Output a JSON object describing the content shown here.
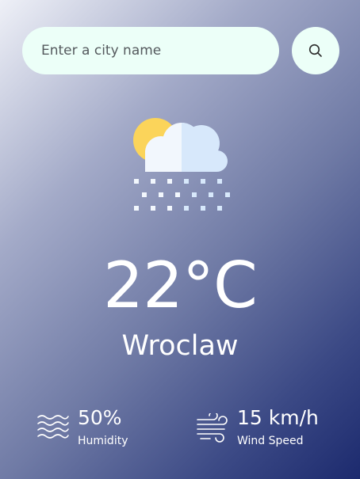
{
  "search": {
    "placeholder": "Enter a city name",
    "value": "",
    "button_icon": "search-icon"
  },
  "weather": {
    "icon": "sun-cloud-snow-icon",
    "temperature": "22°C",
    "city": "Wroclaw"
  },
  "details": {
    "humidity": {
      "value": "50%",
      "label": "Humidity",
      "icon": "humidity-waves-icon"
    },
    "wind": {
      "value": "15 km/h",
      "label": "Wind Speed",
      "icon": "wind-icon"
    }
  },
  "colors": {
    "input_background": "#ecfff8",
    "sun": "#fbd45a",
    "cloud_light": "#f2f7fd",
    "cloud_shade": "#d7e8fb",
    "text": "#ffffff",
    "gradient_start": "#eef0f7",
    "gradient_end": "#1c2a6e"
  }
}
